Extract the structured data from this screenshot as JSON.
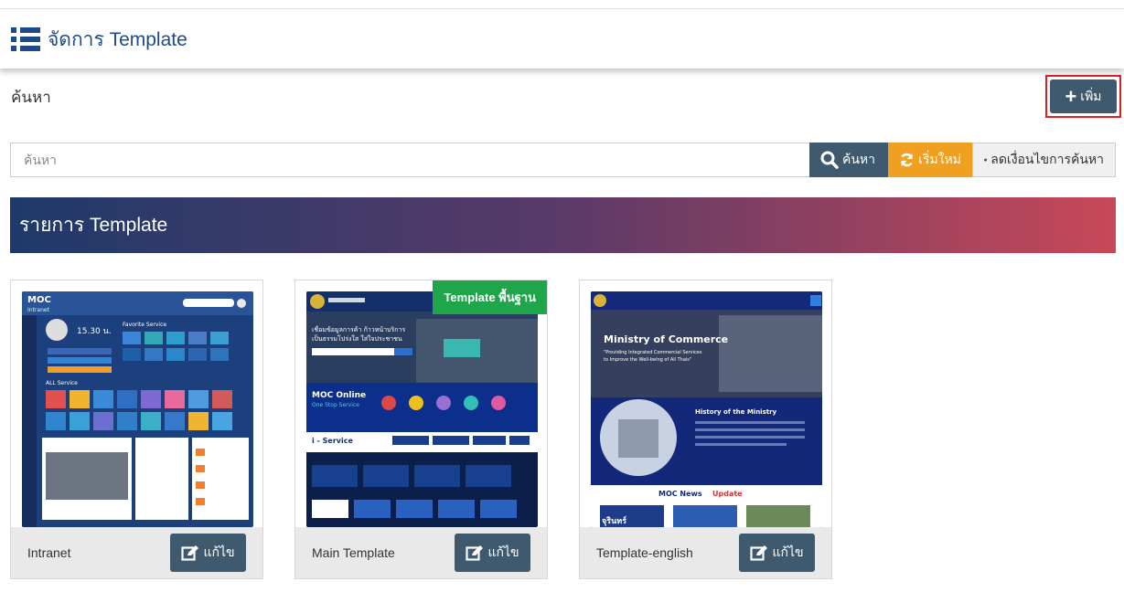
{
  "header": {
    "title": "จัดการ Template"
  },
  "search": {
    "label": "ค้นหา",
    "placeholder": "ค้นหา",
    "add_label": "เพิ่ม",
    "search_btn": "ค้นหา",
    "reset_btn": "เริ่มใหม่",
    "reduce_btn": "ลดเงื่อนไขการค้นหา"
  },
  "list": {
    "title": "รายการ Template"
  },
  "cards": [
    {
      "name": "Intranet",
      "edit_label": "แก้ไข"
    },
    {
      "name": "Main Template",
      "edit_label": "แก้ไข",
      "ribbon": "Template พื้นฐาน"
    },
    {
      "name": "Template-english",
      "edit_label": "แก้ไข"
    }
  ],
  "thumb_text": {
    "intranet": {
      "logo": "MOC",
      "sub": "Intranet",
      "time": "15.30 น.",
      "fav": "Favorite Service",
      "all": "ALL Service"
    },
    "main": {
      "headline": "เชื่อมข้อมูลการค้า ก้าวหน้าบริการ",
      "headline2": "เป็นธรรมโปร่งใส ใส่ใจประชาชน",
      "moc": "MOC Online",
      "stop": "One Stop Service",
      "eservice": "i - Service"
    },
    "english": {
      "title": "Ministry of Commerce",
      "sub1": "\"Providing Integrated Commercial Services",
      "sub2": "to Improve the Well-being of All Thais\"",
      "history": "History of the Ministry",
      "news1": "MOC News",
      "news2": "Update",
      "name": "จุรินทร์"
    }
  },
  "colors": {
    "primary": "#3f5a6f",
    "accent": "#f0a020",
    "ribbon": "#1fa64a",
    "highlight": "#e02020"
  }
}
